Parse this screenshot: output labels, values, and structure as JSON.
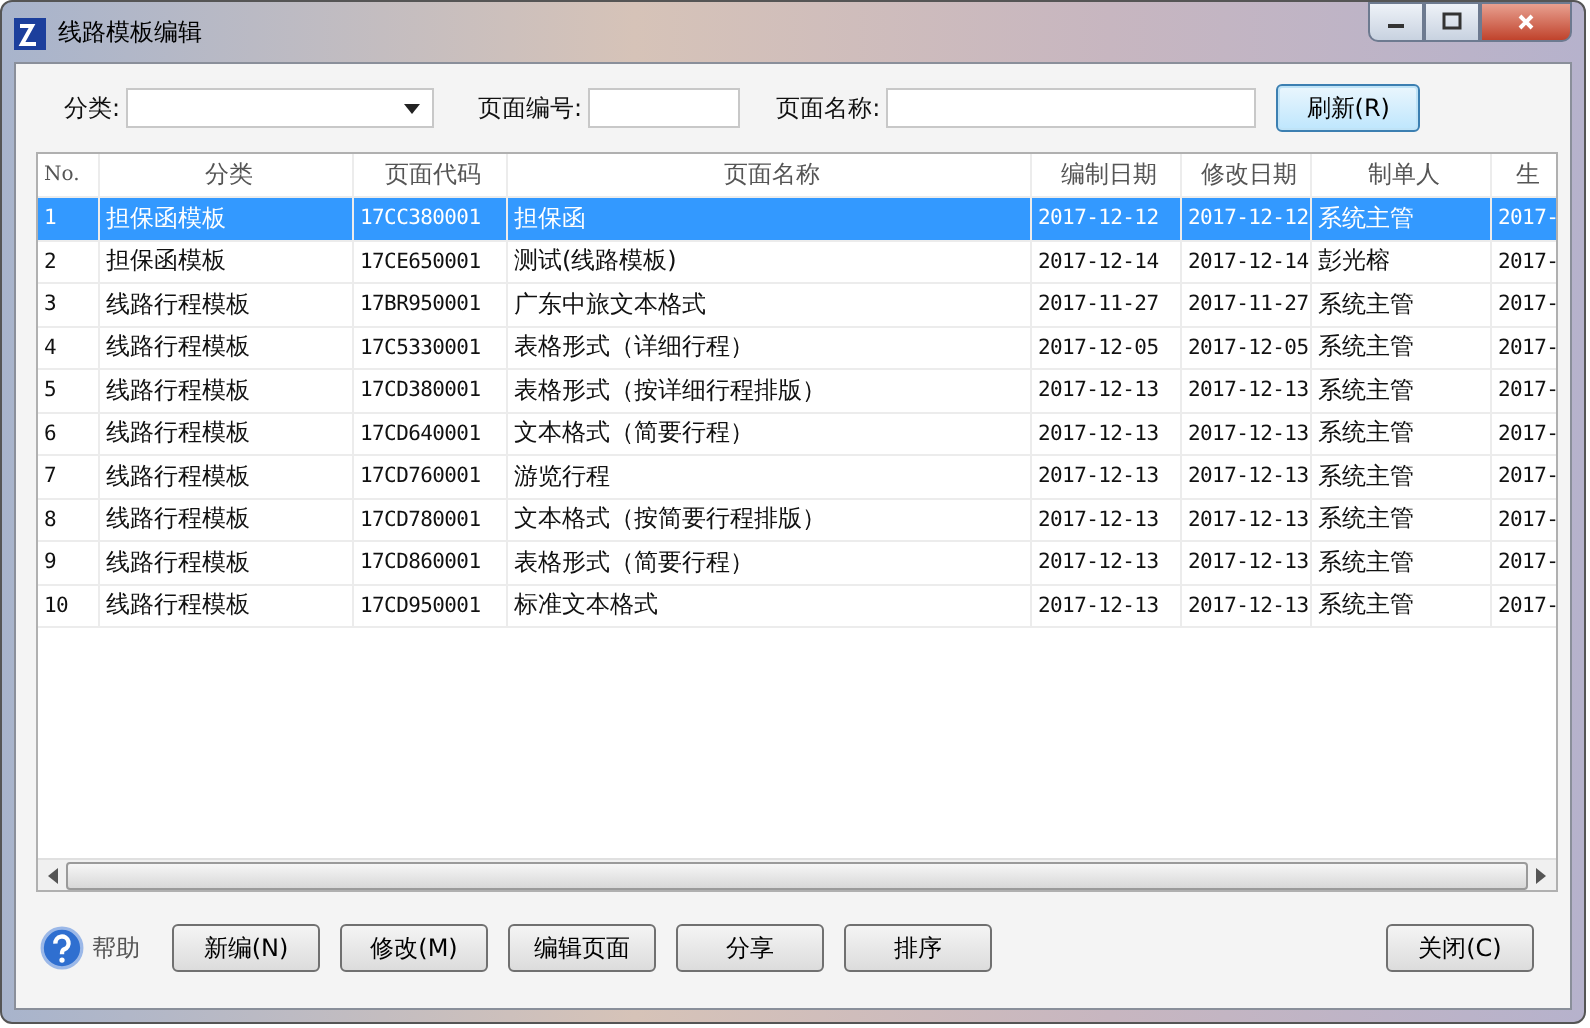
{
  "window": {
    "title": "线路模板编辑"
  },
  "filters": {
    "category": {
      "label": "分类:"
    },
    "page_number": {
      "label": "页面编号:"
    },
    "page_name": {
      "label": "页面名称:"
    },
    "refresh_button": "刷新(R)"
  },
  "table": {
    "columns": [
      "No.",
      "分类",
      "页面代码",
      "页面名称",
      "编制日期",
      "修改日期",
      "制单人",
      "生"
    ],
    "rows": [
      {
        "selected": true,
        "cells": [
          "1",
          "担保函模板",
          "17CC380001",
          "担保函",
          "2017-12-12",
          "2017-12-12",
          "系统主管",
          "2017-"
        ]
      },
      {
        "selected": false,
        "cells": [
          "2",
          "担保函模板",
          "17CE650001",
          "测试(线路模板)",
          "2017-12-14",
          "2017-12-14",
          "彭光榕",
          "2017-"
        ]
      },
      {
        "selected": false,
        "cells": [
          "3",
          "线路行程模板",
          "17BR950001",
          "广东中旅文本格式",
          "2017-11-27",
          "2017-11-27",
          "系统主管",
          "2017-"
        ]
      },
      {
        "selected": false,
        "cells": [
          "4",
          "线路行程模板",
          "17C5330001",
          "表格形式（详细行程）",
          "2017-12-05",
          "2017-12-05",
          "系统主管",
          "2017-"
        ]
      },
      {
        "selected": false,
        "cells": [
          "5",
          "线路行程模板",
          "17CD380001",
          "表格形式（按详细行程排版）",
          "2017-12-13",
          "2017-12-13",
          "系统主管",
          "2017-"
        ]
      },
      {
        "selected": false,
        "cells": [
          "6",
          "线路行程模板",
          "17CD640001",
          "文本格式（简要行程）",
          "2017-12-13",
          "2017-12-13",
          "系统主管",
          "2017-"
        ]
      },
      {
        "selected": false,
        "cells": [
          "7",
          "线路行程模板",
          "17CD760001",
          "游览行程",
          "2017-12-13",
          "2017-12-13",
          "系统主管",
          "2017-"
        ]
      },
      {
        "selected": false,
        "cells": [
          "8",
          "线路行程模板",
          "17CD780001",
          "文本格式（按简要行程排版）",
          "2017-12-13",
          "2017-12-13",
          "系统主管",
          "2017-"
        ]
      },
      {
        "selected": false,
        "cells": [
          "9",
          "线路行程模板",
          "17CD860001",
          "表格形式（简要行程）",
          "2017-12-13",
          "2017-12-13",
          "系统主管",
          "2017-"
        ]
      },
      {
        "selected": false,
        "cells": [
          "10",
          "线路行程模板",
          "17CD950001",
          "标准文本格式",
          "2017-12-13",
          "2017-12-13",
          "系统主管",
          "2017-"
        ]
      }
    ]
  },
  "footer": {
    "help": "帮助",
    "buttons": [
      "新编(N)",
      "修改(M)",
      "编辑页面",
      "分享",
      "排序"
    ],
    "close_button": "关闭(C)"
  }
}
